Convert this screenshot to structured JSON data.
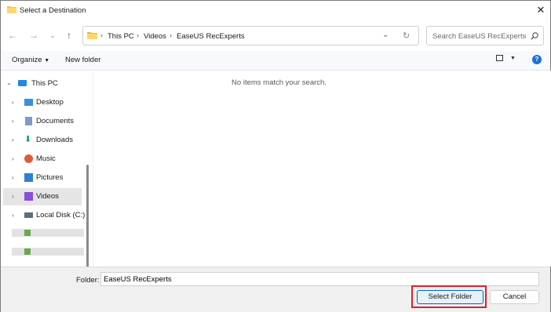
{
  "window": {
    "title": "Select a Destination"
  },
  "nav": {
    "breadcrumb": [
      "This PC",
      "Videos",
      "EaseUS RecExperts"
    ],
    "search_placeholder": "Search EaseUS RecExperts"
  },
  "toolbar": {
    "organize_label": "Organize",
    "new_folder_label": "New folder"
  },
  "sidebar": {
    "items": [
      {
        "label": "This PC"
      },
      {
        "label": "Desktop"
      },
      {
        "label": "Documents"
      },
      {
        "label": "Downloads"
      },
      {
        "label": "Music"
      },
      {
        "label": "Pictures"
      },
      {
        "label": "Videos"
      },
      {
        "label": "Local Disk (C:)"
      }
    ]
  },
  "content": {
    "empty_message": "No items match your search."
  },
  "footer": {
    "folder_label": "Folder:",
    "folder_value": "EaseUS RecExperts",
    "select_button": "Select Folder",
    "cancel_button": "Cancel"
  },
  "colors": {
    "accent": "#0067c0",
    "highlight": "#d9202f",
    "selected_bg": "#e5e5e5"
  }
}
